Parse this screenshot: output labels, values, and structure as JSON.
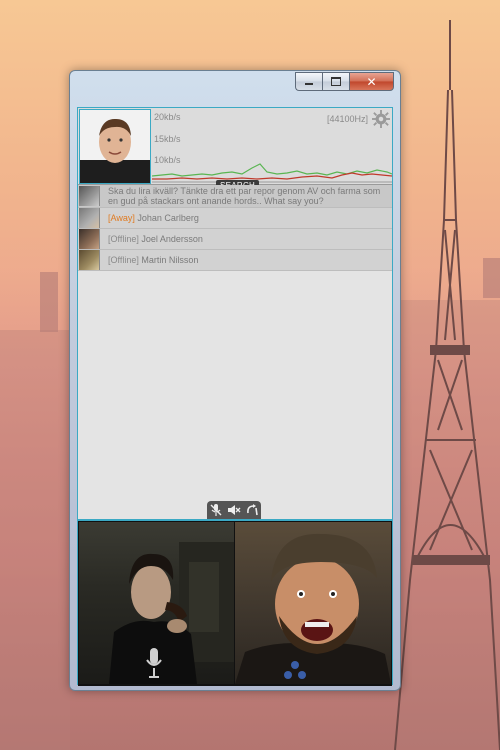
{
  "window": {
    "buttons": {
      "minimize_icon": "minimize-icon",
      "maximize_icon": "maximize-icon",
      "close_icon": "close-icon"
    }
  },
  "graph": {
    "labels": [
      "20kb/s",
      "15kb/s",
      "10kb/s"
    ],
    "sample_rate": "[44100Hz]",
    "search_label": "SEARCH",
    "series_colors": {
      "inbound": "#5ab552",
      "outbound": "#c0392b"
    }
  },
  "contacts": [
    {
      "message": "Ska du lira ikväll? Tänkte dra ett par repor genom AV och farma som en gud på stackars ont anande hords.. What say you?"
    },
    {
      "status": "[Away]",
      "name": "Johan Carlberg"
    },
    {
      "status": "[Offline]",
      "name": "Joel Andersson"
    },
    {
      "status": "[Offline]",
      "name": "Martin Nilsson"
    }
  ],
  "controls": {
    "icons": [
      "mic-muted-icon",
      "speaker-muted-icon",
      "hangup-icon"
    ]
  },
  "colors": {
    "accent": "#3ba9c4",
    "away": "#e07b22"
  }
}
